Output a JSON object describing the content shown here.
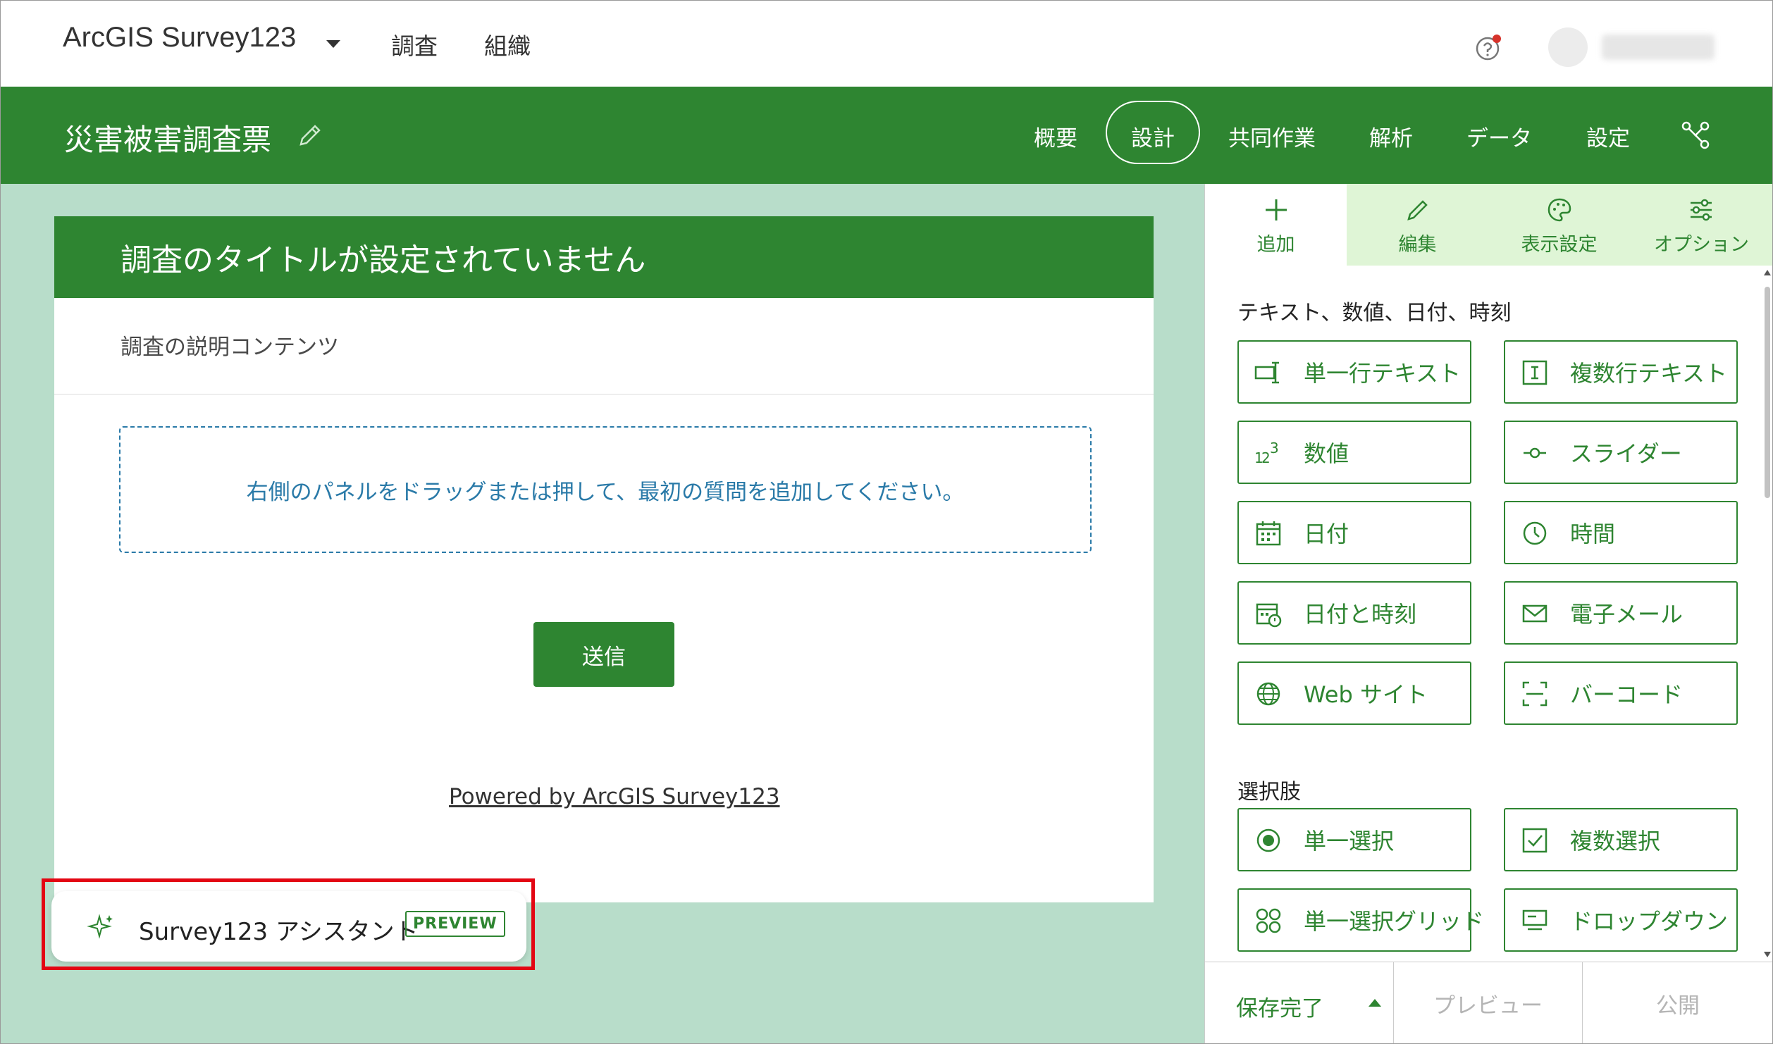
{
  "topnav": {
    "app_name": "ArcGIS Survey123",
    "links": [
      "調査",
      "組織"
    ]
  },
  "survey_header": {
    "title": "災害被害調査票",
    "tabs": [
      "概要",
      "設計",
      "共同作業",
      "解析",
      "データ",
      "設定"
    ],
    "active_tab": "設計"
  },
  "form": {
    "title": "調査のタイトルが設定されていません",
    "description": "調査の説明コンテンツ",
    "dropzone_text": "右側のパネルをドラッグまたは押して、最初の質問を追加してください。",
    "submit_label": "送信",
    "powered_by": "Powered by ArcGIS Survey123"
  },
  "assistant": {
    "label": "Survey123 アシスタント",
    "badge": "PREVIEW"
  },
  "panel": {
    "tabs": [
      {
        "label": "追加",
        "icon": "plus-icon"
      },
      {
        "label": "編集",
        "icon": "pencil-icon"
      },
      {
        "label": "表示設定",
        "icon": "palette-icon"
      },
      {
        "label": "オプション",
        "icon": "sliders-icon"
      }
    ],
    "section1_title": "テキスト、数値、日付、時刻",
    "section1_items": [
      {
        "label": "単一行テキスト",
        "icon": "single-line-text-icon"
      },
      {
        "label": "複数行テキスト",
        "icon": "multiline-text-icon"
      },
      {
        "label": "数値",
        "icon": "number-icon"
      },
      {
        "label": "スライダー",
        "icon": "slider-icon"
      },
      {
        "label": "日付",
        "icon": "calendar-icon"
      },
      {
        "label": "時間",
        "icon": "clock-icon"
      },
      {
        "label": "日付と時刻",
        "icon": "calendar-clock-icon"
      },
      {
        "label": "電子メール",
        "icon": "envelope-icon"
      },
      {
        "label": "Web サイト",
        "icon": "globe-icon"
      },
      {
        "label": "バーコード",
        "icon": "barcode-icon"
      }
    ],
    "section2_title": "選択肢",
    "section2_items": [
      {
        "label": "単一選択",
        "icon": "radio-icon"
      },
      {
        "label": "複数選択",
        "icon": "checkbox-icon"
      },
      {
        "label": "単一選択グリッド",
        "icon": "grid-icon"
      },
      {
        "label": "ドロップダウン",
        "icon": "dropdown-icon"
      }
    ]
  },
  "footer": {
    "save_label": "保存完了",
    "preview_label": "プレビュー",
    "publish_label": "公開"
  },
  "colors": {
    "brand_green": "#2e8531",
    "canvas_bg": "#b8ddca",
    "tab_bg": "#dff5d6",
    "highlight_red": "#e30613",
    "link_blue": "#2a7aa8"
  }
}
